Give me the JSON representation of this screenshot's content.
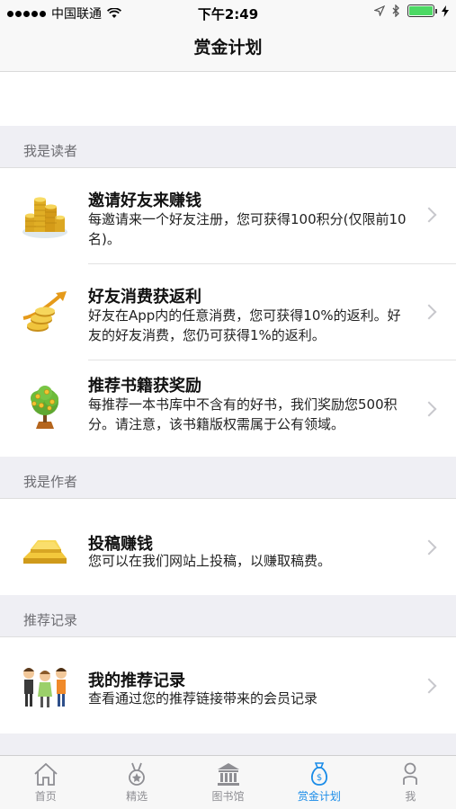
{
  "status_bar": {
    "carrier": "中国联通",
    "time": "下午2:49"
  },
  "nav": {
    "title": "赏金计划"
  },
  "sections": [
    {
      "header": "我是读者",
      "items": [
        {
          "title": "邀请好友来赚钱",
          "desc": "每邀请来一个好友注册，您可获得100积分(仅限前10名)。",
          "icon": "coin-stack-icon"
        },
        {
          "title": "好友消费获返利",
          "desc": "好友在App内的任意消费，您可获得10%的返利。好友的好友消费，您仍可获得1%的返利。",
          "icon": "coins-growth-icon"
        },
        {
          "title": "推荐书籍获奖励",
          "desc": "每推荐一本书库中不含有的好书，我们奖励您500积分。请注意，该书籍版权需属于公有领域。",
          "icon": "money-tree-icon"
        }
      ]
    },
    {
      "header": "我是作者",
      "items": [
        {
          "title": "投稿赚钱",
          "desc": "您可以在我们网站上投稿，以赚取稿费。",
          "icon": "gold-bars-icon"
        }
      ]
    },
    {
      "header": "推荐记录",
      "items": [
        {
          "title": "我的推荐记录",
          "desc": "查看通过您的推荐链接带来的会员记录",
          "icon": "people-group-icon"
        }
      ]
    }
  ],
  "tabs": [
    {
      "label": "首页",
      "icon": "home-icon",
      "active": false
    },
    {
      "label": "精选",
      "icon": "medal-icon",
      "active": false
    },
    {
      "label": "图书馆",
      "icon": "library-icon",
      "active": false
    },
    {
      "label": "赏金计划",
      "icon": "money-bag-icon",
      "active": true
    },
    {
      "label": "我",
      "icon": "person-icon",
      "active": false
    }
  ],
  "colors": {
    "accent": "#1a8ce8",
    "tab_inactive": "#8e8e93",
    "background": "#efeff4"
  }
}
